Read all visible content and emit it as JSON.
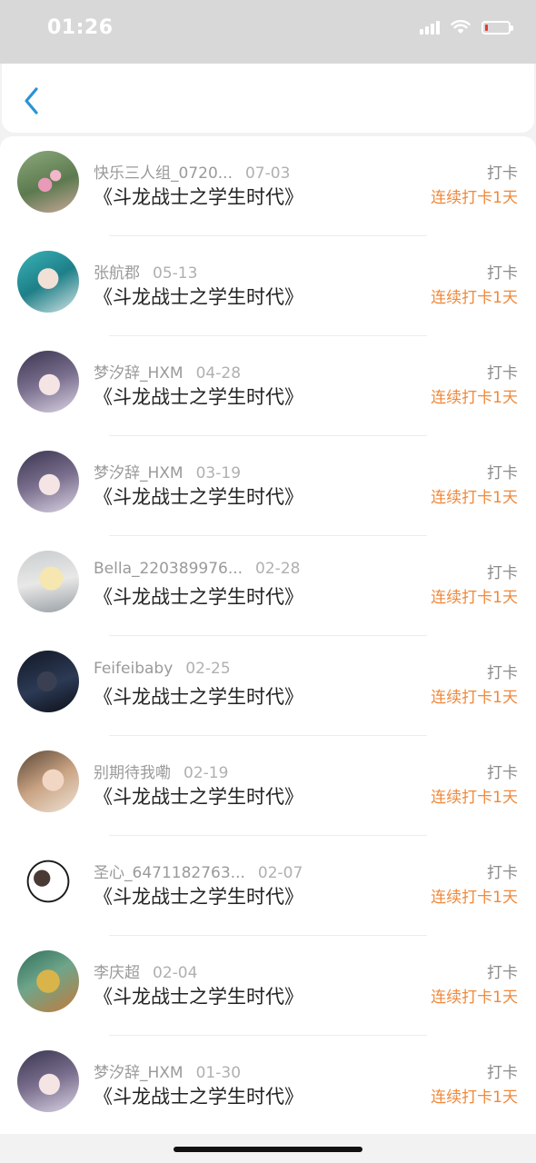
{
  "status_bar": {
    "time": "01:26"
  },
  "nav": {
    "back_icon": "chevron-left-icon"
  },
  "colors": {
    "accent": "#2a93d5",
    "streak": "#f0883a"
  },
  "items": [
    {
      "name": "快乐三人组_0720...",
      "date": "07-03",
      "title": "《斗龙战士之学生时代》",
      "action": "打卡",
      "streak": "连续打卡1天"
    },
    {
      "name": "张航郡",
      "date": "05-13",
      "title": "《斗龙战士之学生时代》",
      "action": "打卡",
      "streak": "连续打卡1天"
    },
    {
      "name": "梦汐辞_HXM",
      "date": "04-28",
      "title": "《斗龙战士之学生时代》",
      "action": "打卡",
      "streak": "连续打卡1天"
    },
    {
      "name": "梦汐辞_HXM",
      "date": "03-19",
      "title": "《斗龙战士之学生时代》",
      "action": "打卡",
      "streak": "连续打卡1天"
    },
    {
      "name": "Bella_220389976...",
      "date": "02-28",
      "title": "《斗龙战士之学生时代》",
      "action": "打卡",
      "streak": "连续打卡1天"
    },
    {
      "name": "Feifeibaby",
      "date": "02-25",
      "title": "《斗龙战士之学生时代》",
      "action": "打卡",
      "streak": "连续打卡1天"
    },
    {
      "name": "别期待我嘞",
      "date": "02-19",
      "title": "《斗龙战士之学生时代》",
      "action": "打卡",
      "streak": "连续打卡1天"
    },
    {
      "name": "圣心_6471182763...",
      "date": "02-07",
      "title": "《斗龙战士之学生时代》",
      "action": "打卡",
      "streak": "连续打卡1天"
    },
    {
      "name": "李庆超",
      "date": "02-04",
      "title": "《斗龙战士之学生时代》",
      "action": "打卡",
      "streak": "连续打卡1天"
    },
    {
      "name": "梦汐辞_HXM",
      "date": "01-30",
      "title": "《斗龙战士之学生时代》",
      "action": "打卡",
      "streak": "连续打卡1天"
    }
  ]
}
